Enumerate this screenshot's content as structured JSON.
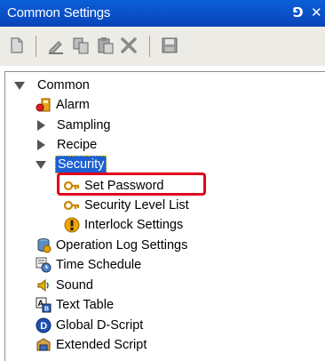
{
  "window": {
    "title": "Common Settings",
    "pin_glyph": "⅁",
    "close_glyph": "✕"
  },
  "toolbar": {
    "icons": [
      "new-page-icon",
      "edit-icon",
      "copy-icon",
      "paste-icon",
      "delete-icon",
      "save-icon"
    ]
  },
  "tree": {
    "root": {
      "label": "Common",
      "expanded": true
    },
    "items": {
      "alarm": {
        "label": "Alarm",
        "icon": "alarm-icon"
      },
      "sampling": {
        "label": "Sampling",
        "expanded": false
      },
      "recipe": {
        "label": "Recipe",
        "expanded": false
      },
      "security": {
        "label": "Security",
        "expanded": true,
        "selected": true
      },
      "set_password": {
        "label": "Set Password",
        "icon": "key-icon"
      },
      "security_level_list": {
        "label": "Security Level List",
        "icon": "key-icon"
      },
      "interlock_settings": {
        "label": "Interlock Settings",
        "icon": "interlock-icon"
      },
      "operation_log_settings": {
        "label": "Operation Log Settings",
        "icon": "database-icon"
      },
      "time_schedule": {
        "label": "Time Schedule",
        "icon": "clock-icon"
      },
      "sound": {
        "label": "Sound",
        "icon": "speaker-icon"
      },
      "text_table": {
        "label": "Text Table",
        "icon": "text-table-icon"
      },
      "global_d_script": {
        "label": "Global D-Script",
        "icon": "d-script-icon"
      },
      "extended_script": {
        "label": "Extended Script",
        "icon": "script-icon"
      }
    }
  },
  "colors": {
    "titlebar": "#0a5fd8",
    "selection": "#1b5fd3",
    "highlight_box": "#e0001b",
    "toolbar_bg": "#ecebe6"
  }
}
